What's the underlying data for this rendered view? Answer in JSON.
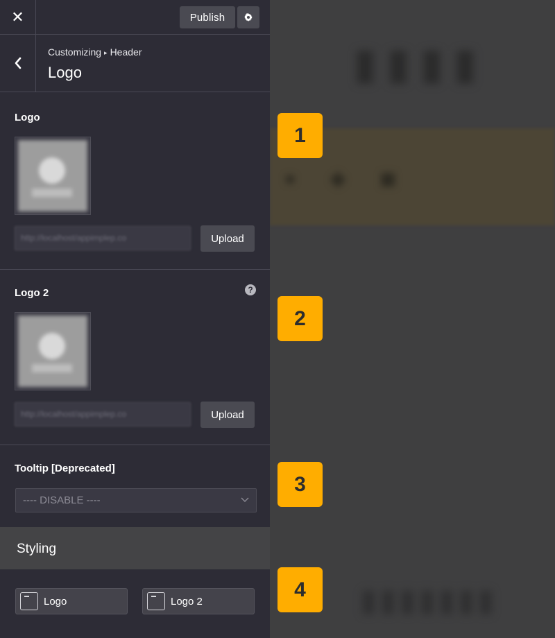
{
  "topbar": {
    "close_icon": "close-icon",
    "publish_label": "Publish",
    "settings_icon": "gear-icon"
  },
  "section": {
    "back_icon": "chevron-left-icon",
    "breadcrumb_parent": "Customizing",
    "breadcrumb_separator": "▸",
    "breadcrumb_child": "Header",
    "title": "Logo"
  },
  "fields": {
    "logo": {
      "label": "Logo",
      "url_value": "http://localhost/appimplep.co",
      "upload_label": "Upload"
    },
    "logo2": {
      "label": "Logo 2",
      "url_value": "http://localhost/appimplep.co",
      "upload_label": "Upload",
      "help_icon": "help-icon"
    },
    "tooltip": {
      "label": "Tooltip [Deprecated]",
      "selected": "---- DISABLE ----"
    }
  },
  "styling": {
    "header": "Styling",
    "items": [
      {
        "label": "Logo",
        "icon": "panel-icon"
      },
      {
        "label": "Logo 2",
        "icon": "panel-icon"
      }
    ]
  },
  "badges": [
    "1",
    "2",
    "3",
    "4"
  ],
  "colors": {
    "badge": "#ffad00",
    "sidebar_bg": "#2d2c36",
    "button_bg": "#4a4a52"
  }
}
